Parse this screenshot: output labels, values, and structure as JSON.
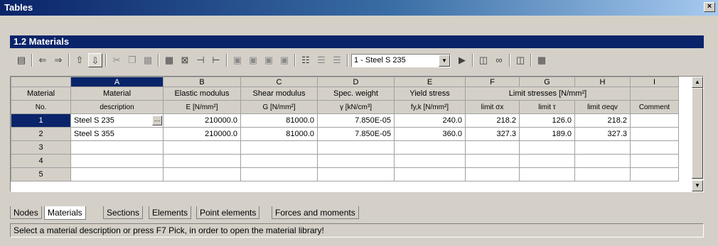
{
  "window": {
    "title": "Tables",
    "close_label": "×"
  },
  "panel": {
    "title": "1.2 Materials"
  },
  "toolbar": {
    "material_select": "1 - Steel S 235",
    "icons": [
      "properties-icon",
      "arrow-left-icon",
      "arrow-right-icon",
      "filter-up-icon",
      "filter-down-icon",
      "cut-icon",
      "copy-icon",
      "paste-icon",
      "insert-column-icon",
      "delete-column-icon",
      "insert-row-icon",
      "append-row-icon",
      "view1-icon",
      "view2-icon",
      "view3-icon",
      "view4-icon",
      "table1-icon",
      "table2-icon",
      "table3-icon",
      "pick-material-icon",
      "info-icon",
      "glasses-icon",
      "import-icon",
      "calculator-icon"
    ]
  },
  "table": {
    "column_letters": [
      "A",
      "B",
      "C",
      "D",
      "E",
      "F",
      "G",
      "H",
      "I"
    ],
    "corner_header": "",
    "header_row1": {
      "material_no": "Material",
      "material_desc": "Material",
      "elastic": "Elastic modulus",
      "shear": "Shear modulus",
      "spec_weight": "Spec. weight",
      "yield": "Yield stress",
      "limit_stresses": "Limit stresses [N/mm²]",
      "comment": ""
    },
    "header_row2": {
      "material_no": "No.",
      "material_desc": "description",
      "elastic": "E [N/mm²]",
      "shear": "G [N/mm²]",
      "spec_weight": "γ [kN/cm³]",
      "yield": "fy,k [N/mm²]",
      "limit_sigma_x": "limit σx",
      "limit_tau": "limit τ",
      "limit_sigma_eqv": "limit σeqv",
      "comment": "Comment"
    },
    "rows": [
      {
        "no": "1",
        "desc": "Steel S 235",
        "E": "210000.0",
        "G": "81000.0",
        "gamma": "7.850E-05",
        "fyk": "240.0",
        "sx": "218.2",
        "tau": "126.0",
        "seqv": "218.2",
        "comment": ""
      },
      {
        "no": "2",
        "desc": "Steel S 355",
        "E": "210000.0",
        "G": "81000.0",
        "gamma": "7.850E-05",
        "fyk": "360.0",
        "sx": "327.3",
        "tau": "189.0",
        "seqv": "327.3",
        "comment": ""
      },
      {
        "no": "3",
        "desc": "",
        "E": "",
        "G": "",
        "gamma": "",
        "fyk": "",
        "sx": "",
        "tau": "",
        "seqv": "",
        "comment": ""
      },
      {
        "no": "4",
        "desc": "",
        "E": "",
        "G": "",
        "gamma": "",
        "fyk": "",
        "sx": "",
        "tau": "",
        "seqv": "",
        "comment": ""
      },
      {
        "no": "5",
        "desc": "",
        "E": "",
        "G": "",
        "gamma": "",
        "fyk": "",
        "sx": "",
        "tau": "",
        "seqv": "",
        "comment": ""
      }
    ]
  },
  "tabs": [
    "Nodes",
    "Materials",
    "Sections",
    "Elements",
    "Point elements",
    "Forces and moments"
  ],
  "active_tab": "Materials",
  "status": "Select a material description or press F7 Pick, in order to open the material library!"
}
